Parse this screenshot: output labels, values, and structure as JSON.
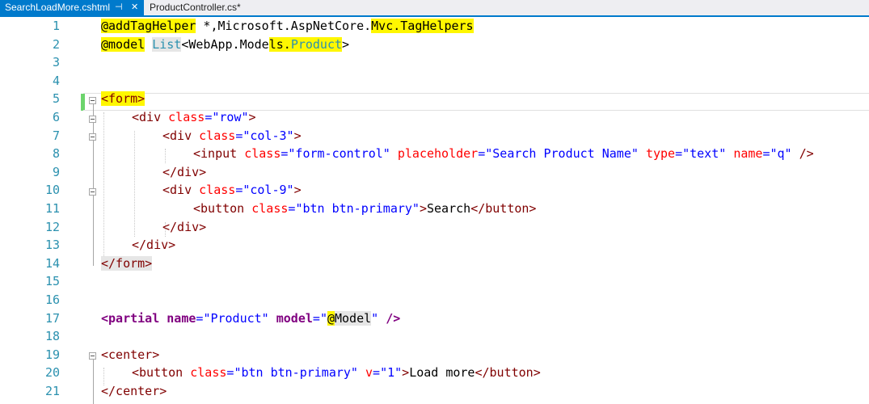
{
  "tabs": [
    {
      "label": "SearchLoadMore.cshtml",
      "active": true
    },
    {
      "label": "ProductController.cs*",
      "active": false
    }
  ],
  "icons": {
    "pin": "pin-icon",
    "close": "close-icon"
  },
  "lines": [
    {
      "n": "1"
    },
    {
      "n": "2"
    },
    {
      "n": "3"
    },
    {
      "n": "4"
    },
    {
      "n": "5"
    },
    {
      "n": "6"
    },
    {
      "n": "7"
    },
    {
      "n": "8"
    },
    {
      "n": "9"
    },
    {
      "n": "10"
    },
    {
      "n": "11"
    },
    {
      "n": "12"
    },
    {
      "n": "13"
    },
    {
      "n": "14"
    },
    {
      "n": "15"
    },
    {
      "n": "16"
    },
    {
      "n": "17"
    },
    {
      "n": "18"
    },
    {
      "n": "19"
    },
    {
      "n": "20"
    },
    {
      "n": "21"
    }
  ],
  "code": {
    "l1": {
      "directive": "@addTagHelper",
      "rest": " *,Microsoft.AspNetCore.",
      "hl": "Mvc.TagHelpers"
    },
    "l2": {
      "directive": "@model",
      "sp": " ",
      "type": "List",
      "mid": "<WebApp.Mode",
      "hl1": "ls.",
      "hl2": "Product",
      "end": ">"
    },
    "l5": {
      "tag": "<form>"
    },
    "l6": {
      "open": "<div",
      "attr": "class",
      "eq": "=",
      "val": "\"row\"",
      "close": ">"
    },
    "l7": {
      "open": "<div",
      "attr": "class",
      "eq": "=",
      "val": "\"col-3\"",
      "close": ">"
    },
    "l8": {
      "open": "<input",
      "a1": "class",
      "v1": "\"form-control\"",
      "a2": "placeholder",
      "v2": "\"Search Product Name\"",
      "a3": "type",
      "v3": "\"text\"",
      "a4": "name",
      "v4": "\"q\"",
      "close": "/>"
    },
    "l9": {
      "tag": "</div>"
    },
    "l10": {
      "open": "<div",
      "attr": "class",
      "eq": "=",
      "val": "\"col-9\"",
      "close": ">"
    },
    "l11": {
      "open": "<button",
      "attr": "class",
      "val": "\"btn btn-primary\"",
      "text": "Search",
      "end": "</button>"
    },
    "l12": {
      "tag": "</div>"
    },
    "l13": {
      "tag": "</div>"
    },
    "l14": {
      "tag": "</form>"
    },
    "l17": {
      "open": "<partial",
      "a1": "name",
      "v1": "\"Product\"",
      "a2": "model",
      "q1": "\"",
      "at": "@",
      "mdl": "Model",
      "q2": "\"",
      "close": "/>"
    },
    "l19": {
      "tag": "<center>"
    },
    "l20": {
      "open": "<button",
      "a1": "class",
      "v1": "\"btn btn-primary\"",
      "a2": "v",
      "v2": "\"1\"",
      "text": "Load more",
      "end": "</button>"
    },
    "l21": {
      "tag": "</center>"
    }
  }
}
